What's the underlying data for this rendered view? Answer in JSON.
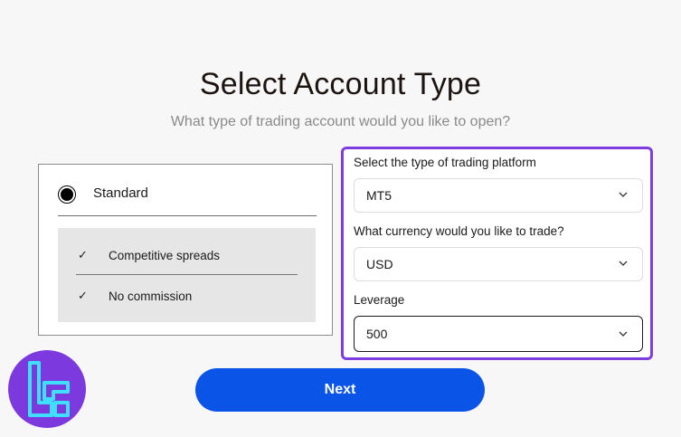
{
  "header": {
    "title": "Select Account Type",
    "subtitle": "What type of trading account would you like to open?"
  },
  "account": {
    "selected_type": "Standard",
    "features": [
      "Competitive spreads",
      "No commission"
    ]
  },
  "platform_form": {
    "platform_label": "Select the type of trading platform",
    "platform_value": "MT5",
    "currency_label": "What currency would you like to trade?",
    "currency_value": "USD",
    "leverage_label": "Leverage",
    "leverage_value": "500"
  },
  "actions": {
    "next_label": "Next"
  },
  "colors": {
    "accent_purple": "#7f3de0",
    "button_blue": "#0a55e8",
    "logo_bg": "#7b39de",
    "logo_mark": "#3fe0ff"
  },
  "icons": [
    "radio-selected-icon",
    "check-icon",
    "chevron-down-icon",
    "brand-logo-icon"
  ]
}
